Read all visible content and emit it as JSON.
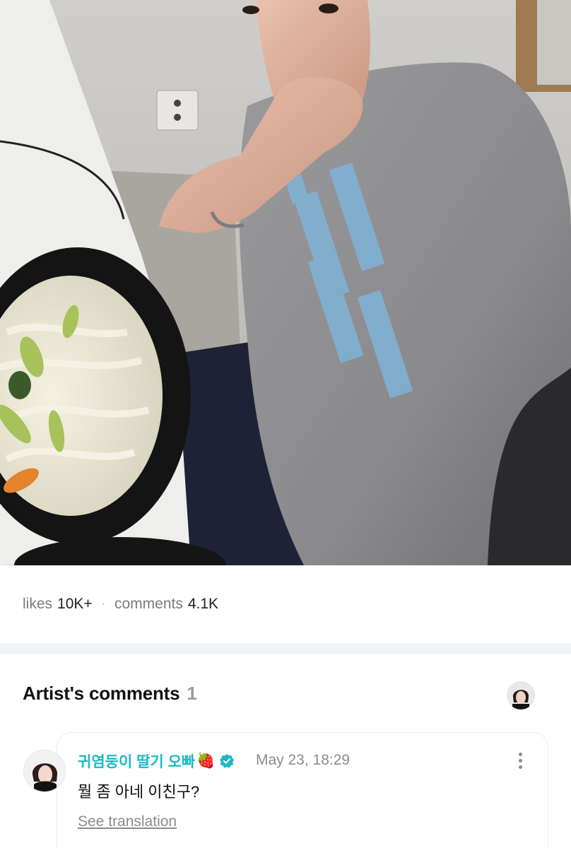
{
  "post": {
    "photo": {
      "description_icon": "post-photo"
    },
    "stats": {
      "likes_label": "likes",
      "likes_value": "10K+",
      "separator": "·",
      "comments_label": "comments",
      "comments_value": "4.1K"
    }
  },
  "artist_comments": {
    "title": "Artist's comments",
    "count": "1",
    "comments": [
      {
        "author": "귀염둥이 딸기 오빠",
        "author_emoji": "🍓",
        "verified_icon": "verified-badge-icon",
        "date": "May 23, 18:29",
        "text": "뭘 좀 아네 이친구?",
        "translate_label": "See translation"
      }
    ]
  },
  "colors": {
    "accent": "#1bb9c5",
    "muted": "#8c8c8c",
    "divider": "#f2f3f5"
  }
}
